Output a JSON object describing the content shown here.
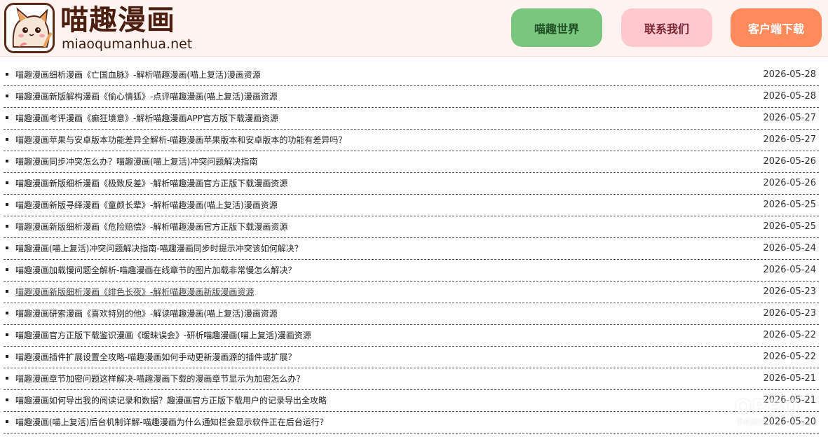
{
  "brand": {
    "title": "喵趣漫画",
    "domain": "miaoqumanhua.net"
  },
  "nav": {
    "world": "喵趣世界",
    "contact": "联系我们",
    "download": "客户端下载"
  },
  "colors": {
    "header_bg": "#fff4f2",
    "world_btn": "#7bc67e",
    "contact_btn": "#ffc9cf",
    "download_btn": "#ff8a5c"
  },
  "articles": [
    {
      "title": "喵趣漫画细析漫画《亡国血脉》-解析喵趣漫画(喵上复活)漫画资源",
      "date": "2026-05-28"
    },
    {
      "title": "喵趣漫画新版解构漫画《偷心情狐》-点评喵趣漫画(喵上复活)漫画资源",
      "date": "2026-05-28"
    },
    {
      "title": "喵趣漫画考评漫画《癫狂境意》-解析喵趣漫画APP官方版下载漫画资源",
      "date": "2026-05-27"
    },
    {
      "title": "喵趣漫画苹果与安卓版本功能差异全解析-喵趣漫画苹果版本和安卓版本的功能有差异吗？",
      "date": "2026-05-27"
    },
    {
      "title": "喵趣漫画同步冲突怎么办？喵趣漫画(喵上复活)冲突问题解决指南",
      "date": "2026-05-26"
    },
    {
      "title": "喵趣漫画新版细析漫画《极致反差》-解析喵趣漫画官方正版下载漫画资源",
      "date": "2026-05-26"
    },
    {
      "title": "喵趣漫画新版寻绎漫画《童颜长辈》-解析喵趣漫画(喵上复活)漫画资源",
      "date": "2026-05-25"
    },
    {
      "title": "喵趣漫画新版细析漫画《危险赔偿》-解析喵趣漫画官方正版下载漫画资源",
      "date": "2026-05-25"
    },
    {
      "title": "喵趣漫画(喵上复活)冲突问题解决指南-喵趣漫画同步时提示冲突该如何解决？",
      "date": "2026-05-24"
    },
    {
      "title": "喵趣漫画加载慢问题全解析-喵趣漫画在线章节的图片加载非常慢怎么解决？",
      "date": "2026-05-24"
    },
    {
      "title": "喵趣漫画新版细析漫画《绯色长夜》-解析喵趣漫画新版漫画资源",
      "date": "2026-05-23",
      "hover": true
    },
    {
      "title": "喵趣漫画研索漫画《喜欢特别的他》-解读喵趣漫画(喵上复活)漫画资源",
      "date": "2026-05-23"
    },
    {
      "title": "喵趣漫画官方正版下载鉴识漫画《暧昧误会》-研析喵趣漫画(喵上复活)漫画资源",
      "date": "2026-05-22"
    },
    {
      "title": "喵趣漫画插件扩展设置全攻略-喵趣漫画如何手动更新漫画源的插件或扩展？",
      "date": "2026-05-22"
    },
    {
      "title": "喵趣漫画章节加密问题这样解决-喵趣漫画下载的漫画章节显示为加密怎么办？",
      "date": "2026-05-21"
    },
    {
      "title": "喵趣漫画如何导出我的阅读记录和数据？趣漫画官方正版下载用户的记录导出全攻略",
      "date": "2026-05-21"
    },
    {
      "title": "喵趣漫画(喵上复活)后台机制详解-喵趣漫画为什么通知栏会显示软件正在后台运行？",
      "date": "2026-05-20"
    }
  ],
  "watermark": {
    "text": "OPPO",
    "sub": "手机软件"
  }
}
